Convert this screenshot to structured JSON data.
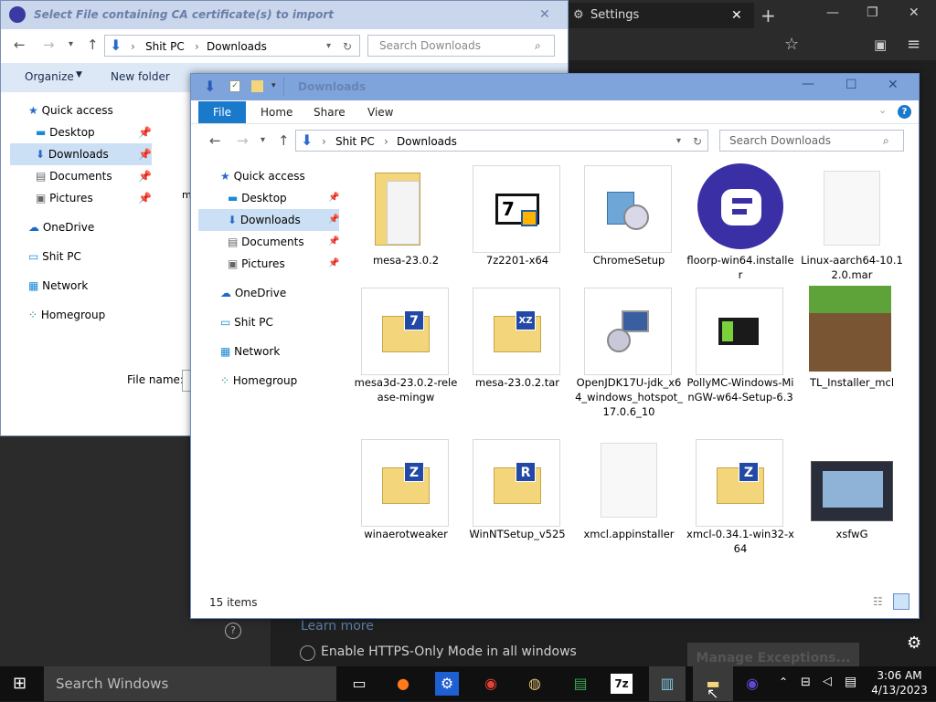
{
  "settings_window": {
    "tab_title": "Settings",
    "learn_more": "Learn more",
    "https_only_label": "Enable HTTPS-Only Mode in all windows",
    "manage_exceptions": "Manage Exceptions..."
  },
  "import_dialog": {
    "title": "Select File containing CA certificate(s) to import",
    "breadcrumb": [
      "Shit PC",
      "Downloads"
    ],
    "search_placeholder": "Search Downloads",
    "organize": "Organize",
    "new_folder": "New folder",
    "sidebar": [
      {
        "label": "Quick access"
      },
      {
        "label": "Desktop"
      },
      {
        "label": "Downloads"
      },
      {
        "label": "Documents"
      },
      {
        "label": "Pictures"
      },
      {
        "label": "OneDrive"
      },
      {
        "label": "Shit PC"
      },
      {
        "label": "Network"
      },
      {
        "label": "Homegroup"
      }
    ],
    "file_name_label": "File name:",
    "partial_item": "me"
  },
  "explorer": {
    "title": "Downloads",
    "menu": {
      "file": "File",
      "home": "Home",
      "share": "Share",
      "view": "View"
    },
    "breadcrumb": [
      "Shit PC",
      "Downloads"
    ],
    "search_placeholder": "Search Downloads",
    "sidebar": [
      {
        "label": "Quick access"
      },
      {
        "label": "Desktop"
      },
      {
        "label": "Downloads"
      },
      {
        "label": "Documents"
      },
      {
        "label": "Pictures"
      },
      {
        "label": "OneDrive"
      },
      {
        "label": "Shit PC"
      },
      {
        "label": "Network"
      },
      {
        "label": "Homegroup"
      }
    ],
    "items": [
      {
        "name": "mesa-23.0.2",
        "icon": "folder-icon"
      },
      {
        "name": "7z2201-x64",
        "icon": "7zip-installer-icon"
      },
      {
        "name": "ChromeSetup",
        "icon": "installer-box-icon"
      },
      {
        "name": "floorp-win64.installer",
        "icon": "floorp-icon"
      },
      {
        "name": "Linux-aarch64-10.12.0.mar",
        "icon": "blank-file-icon"
      },
      {
        "name": "mesa3d-23.0.2-release-mingw",
        "icon": "7z-archive-icon"
      },
      {
        "name": "mesa-23.0.2.tar",
        "icon": "xz-archive-icon"
      },
      {
        "name": "OpenJDK17U-jdk_x64_windows_hotspot_17.0.6_10",
        "icon": "msi-installer-icon"
      },
      {
        "name": "PollyMC-Windows-MinGW-w64-Setup-6.3",
        "icon": "pollymc-icon"
      },
      {
        "name": "TL_Installer_mcl",
        "icon": "grass-block-icon"
      },
      {
        "name": "winaerotweaker",
        "icon": "zip-archive-icon"
      },
      {
        "name": "WinNTSetup_v525",
        "icon": "rar-archive-icon"
      },
      {
        "name": "xmcl.appinstaller",
        "icon": "blank-file-icon"
      },
      {
        "name": "xmcl-0.34.1-win32-x64",
        "icon": "zip-archive-icon"
      },
      {
        "name": "xsfwG",
        "icon": "image-thumbnail-icon"
      }
    ],
    "status": "15 items"
  },
  "taskbar": {
    "search_placeholder": "Search Windows",
    "time": "3:06 AM",
    "date": "4/13/2023"
  }
}
